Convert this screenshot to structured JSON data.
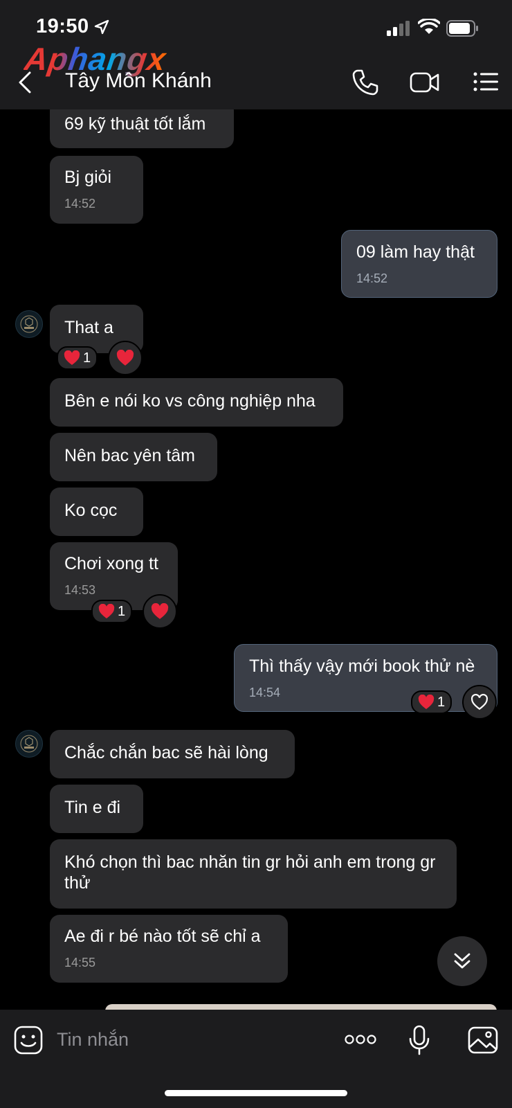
{
  "status_bar": {
    "time": "19:50"
  },
  "watermark": "Aphangx",
  "header": {
    "contact_name": "Tây Môn Khánh"
  },
  "messages": [
    {
      "text": "69 kỹ thuật tốt lắm"
    },
    {
      "text": "Bj giỏi",
      "time": "14:52"
    },
    {
      "text": "09 làm hay thật",
      "time": "14:52"
    },
    {
      "text": "That a",
      "reaction_count": "1"
    },
    {
      "text": "Bên e nói ko vs công nghiệp nha"
    },
    {
      "text": "Nên bac yên tâm"
    },
    {
      "text": "Ko cọc"
    },
    {
      "text": "Chơi xong tt",
      "time": "14:53",
      "reaction_count": "1"
    },
    {
      "text": "Thì thấy vậy mới book thử nè",
      "time": "14:54",
      "reaction_count": "1"
    },
    {
      "text": "Chắc chắn bac sẽ hài lòng"
    },
    {
      "text": "Tin e đi"
    },
    {
      "text": "Khó chọn thì bac nhăn tin gr hỏi anh em trong gr thử"
    },
    {
      "text": "Ae đi r bé nào tốt sẽ chỉ a",
      "time": "14:55"
    }
  ],
  "composer": {
    "placeholder": "Tin nhắn"
  },
  "colors": {
    "incoming_bubble": "#2b2b2d",
    "outgoing_bubble": "#3a3e47",
    "heart": "#e8253b"
  }
}
